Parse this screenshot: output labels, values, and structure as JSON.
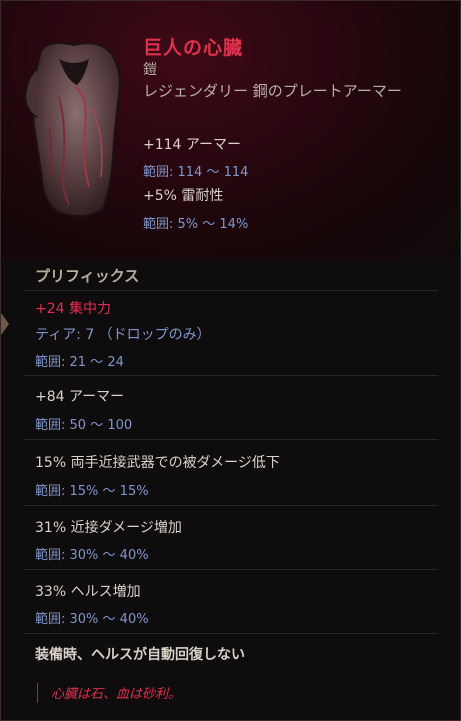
{
  "item": {
    "name": "巨人の心臓",
    "slot": "鎧",
    "rarity_type": "レジェンダリー 鋼のプレートアーマー",
    "base_stats": [
      {
        "text": "+114 アーマー",
        "range": "範囲: 114 〜 114"
      },
      {
        "text": "+5% 雷耐性",
        "range": "範囲: 5% 〜 14%"
      }
    ]
  },
  "prefix": {
    "title": "プリフィックス",
    "primary": {
      "text": "+24 集中力",
      "tier": "ティア: 7 （ドロップのみ）",
      "range": "範囲: 21 〜 24"
    },
    "affixes": [
      {
        "text": "+84 アーマー",
        "range": "範囲: 50 〜 100"
      },
      {
        "text": "15% 両手近接武器での被ダメージ低下",
        "range": "範囲: 15% 〜 15%"
      },
      {
        "text": "31% 近接ダメージ増加",
        "range": "範囲: 30% 〜 40%"
      },
      {
        "text": "33% ヘルス増加",
        "range": "範囲: 30% 〜 40%"
      }
    ]
  },
  "equip_effect": "装備時、ヘルスが自動回復しない",
  "flavor": "心臓は石、血は砂利。",
  "colors": {
    "legendary": "#e0304e",
    "range": "#7e97cc",
    "text": "#d8d2c9"
  }
}
